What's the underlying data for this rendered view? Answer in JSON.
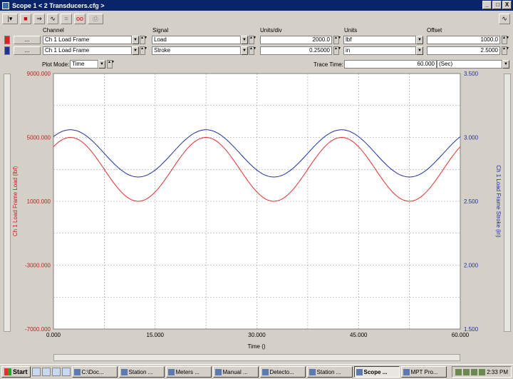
{
  "window": {
    "title": "Scope  1 < 2 Transducers.cfg >",
    "buttons": [
      "_",
      " □",
      "X"
    ]
  },
  "toolbar": {
    "items": [
      {
        "icon": "dropdown-icon",
        "glyph": "|▾"
      },
      {
        "icon": "stop-icon",
        "glyph": "■"
      },
      {
        "icon": "arrow-icon",
        "glyph": "⇒"
      },
      {
        "icon": "wave-icon",
        "glyph": "∿"
      },
      {
        "icon": "list-icon",
        "glyph": "≡"
      },
      {
        "icon": "loop-icon",
        "glyph": "oo"
      },
      {
        "icon": "print-icon",
        "glyph": "⎙"
      }
    ],
    "right_icon": "∿"
  },
  "headers": {
    "channel": "Channel",
    "signal": "Signal",
    "units_div": "Units/div",
    "units": "Units",
    "offset": "Offset"
  },
  "rows": [
    {
      "color": "#e02020",
      "dots": "...",
      "channel": "Ch 1 Load Frame",
      "signal": "Load",
      "units_div": "2000.0",
      "units": "lbf",
      "offset": "1000.0"
    },
    {
      "color": "#2030a0",
      "dots": "...",
      "channel": "Ch 1 Load Frame",
      "signal": "Stroke",
      "units_div": "0.25000",
      "units": "in",
      "offset": "2.5000"
    }
  ],
  "plot_mode": {
    "label": "Plot Mode:",
    "value": "Time"
  },
  "trace_time": {
    "label": "Trace Time:",
    "value": "60.000",
    "unit": "(Sec)"
  },
  "chart_data": {
    "type": "line",
    "xlabel": "Time ()",
    "xlim": [
      0,
      60
    ],
    "x_ticks": [
      "0.000",
      "15.000",
      "30.000",
      "45.000",
      "60.000"
    ],
    "left_axis": {
      "label": "Ch 1 Load Frame Load (lbf)",
      "ylim": [
        -7000,
        9000
      ],
      "ticks": [
        "9000.000",
        "5000.000",
        "1000.000",
        "-3000.000",
        "-7000.000"
      ],
      "color": "#c02020"
    },
    "right_axis": {
      "label": "Ch 1 Load Frame Stroke (in)",
      "ylim": [
        1.5,
        3.5
      ],
      "ticks": [
        "3.500",
        "3.000",
        "2.500",
        "2.000",
        "1.500"
      ],
      "color": "#2030a0"
    },
    "series": [
      {
        "axis": "left",
        "color": "#e03030",
        "period": 20,
        "mean": 3000,
        "amplitude": 2000,
        "peak_time": 2.5
      },
      {
        "axis": "right",
        "color": "#2030a0",
        "period": 20,
        "mean": 2.875,
        "amplitude": 0.185,
        "peak_time": 2.5
      }
    ]
  },
  "taskbar": {
    "start": "Start",
    "tasks": [
      {
        "label": "C:\\Doc...",
        "active": false
      },
      {
        "label": "Station ...",
        "active": false
      },
      {
        "label": "Meters ...",
        "active": false
      },
      {
        "label": "Manual ...",
        "active": false
      },
      {
        "label": "Detecto...",
        "active": false
      },
      {
        "label": "Station ...",
        "active": false
      },
      {
        "label": "Scope ...",
        "active": true
      },
      {
        "label": "MPT Pro...",
        "active": false
      }
    ],
    "clock": "2:33 PM"
  }
}
